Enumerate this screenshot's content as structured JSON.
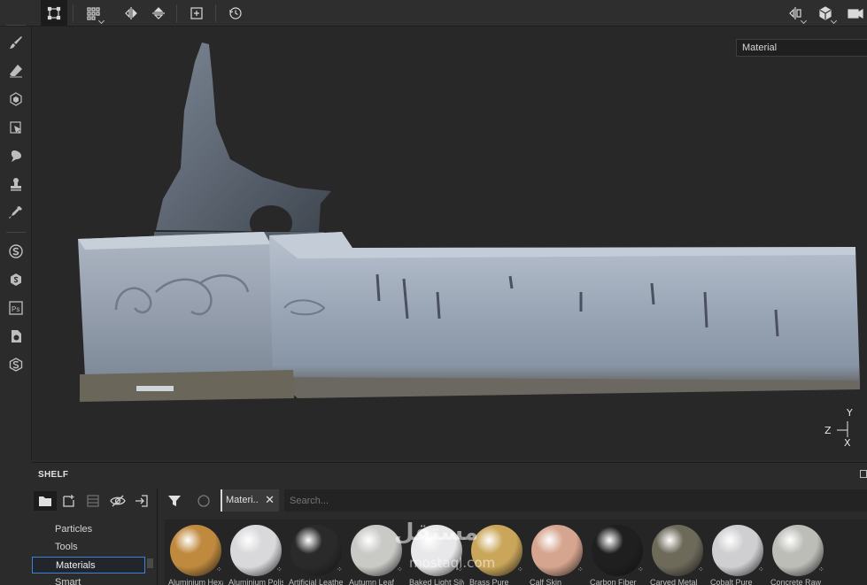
{
  "viewport": {
    "channel_select": "Material",
    "axis": {
      "y": "Y",
      "z": "Z",
      "x": "X"
    }
  },
  "shelf": {
    "title": "SHELF",
    "categories": [
      {
        "label": "Particles"
      },
      {
        "label": "Tools"
      },
      {
        "label": "Materials"
      },
      {
        "label": "Smart materials"
      }
    ],
    "filter_chip": "Materi..",
    "search_placeholder": "Search...",
    "materials": [
      {
        "name": "Aluminium Hexagonal",
        "color": "#c08a3e"
      },
      {
        "name": "Aluminium Polished",
        "color": "#d9d9dc"
      },
      {
        "name": "Artificial Leather",
        "color": "#2a2a2a"
      },
      {
        "name": "Autumn Leaf",
        "color": "#c9c9c6"
      },
      {
        "name": "Baked Light Silver",
        "color": "#e8e8ea"
      },
      {
        "name": "Brass Pure",
        "color": "#caa65a"
      },
      {
        "name": "Calf Skin",
        "color": "#d6a58f"
      },
      {
        "name": "Carbon Fiber",
        "color": "#1f1f1f"
      },
      {
        "name": "Carved Metal",
        "color": "#6d6a5a"
      },
      {
        "name": "Cobalt Pure",
        "color": "#cfcfd2"
      },
      {
        "name": "Concrete Raw",
        "color": "#bdbdb8"
      }
    ]
  },
  "watermark": {
    "main": "مستقل",
    "sub": "mostaql.com"
  }
}
